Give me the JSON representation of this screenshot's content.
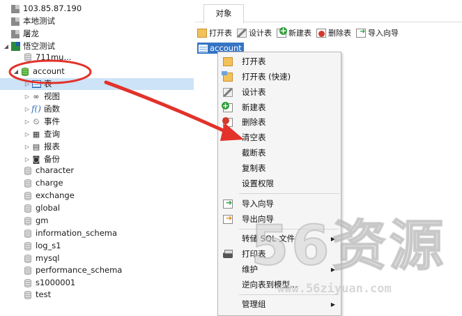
{
  "tree": {
    "connections": [
      {
        "label": "103.85.87.190"
      },
      {
        "label": "本地测试"
      },
      {
        "label": "屠龙"
      },
      {
        "label": "悟空测试"
      }
    ],
    "partial_item": "711mu...",
    "selected_db": "account",
    "db_children": [
      "表",
      "视图",
      "函数",
      "事件",
      "查询",
      "报表",
      "备份"
    ],
    "other_databases": [
      "character",
      "charge",
      "exchange",
      "global",
      "gm",
      "information_schema",
      "log_s1",
      "mysql",
      "performance_schema",
      "s1000001",
      "test"
    ]
  },
  "tabs": {
    "objects": "对象"
  },
  "toolbar": {
    "open": "打开表",
    "design": "设计表",
    "new": "新建表",
    "delete": "删除表",
    "import": "导入向导"
  },
  "object_item": "account",
  "context_menu": [
    "打开表",
    "打开表 (快速)",
    "设计表",
    "新建表",
    "删除表",
    "清空表",
    "截断表",
    "复制表",
    "设置权限",
    "导入向导",
    "导出向导",
    "转储 SQL 文件",
    "打印表",
    "维护",
    "逆向表到模型...",
    "管理组"
  ],
  "watermark": {
    "big": "56资源",
    "url": "www.56ziyuan.com"
  },
  "colors": {
    "selection": "#3574c4",
    "tree_selection": "#cde3f7",
    "arrow": "#e2322a"
  }
}
